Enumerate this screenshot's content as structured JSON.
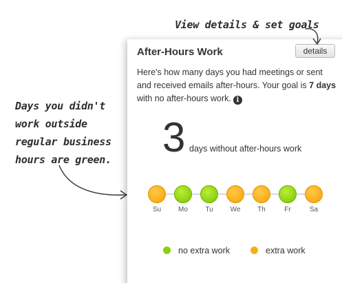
{
  "annotations": {
    "top": "View details & set goals",
    "left_lines": [
      "Days you didn't",
      "work outside",
      "regular business",
      "hours are green."
    ]
  },
  "card": {
    "title": "After-Hours Work",
    "details_label": "details",
    "description_pre": "Here's how many days you had meetings or sent and received emails after-hours. Your goal is ",
    "goal_bold": "7 days",
    "description_post": " with no after-hours work.",
    "info_icon": "info-icon",
    "count": "3",
    "count_caption": "days without after-hours work"
  },
  "days": [
    {
      "label": "Su",
      "status": "extra"
    },
    {
      "label": "Mo",
      "status": "none"
    },
    {
      "label": "Tu",
      "status": "none"
    },
    {
      "label": "We",
      "status": "extra"
    },
    {
      "label": "Th",
      "status": "extra"
    },
    {
      "label": "Fr",
      "status": "none"
    },
    {
      "label": "Sa",
      "status": "extra"
    }
  ],
  "legend": {
    "none_label": "no extra work",
    "extra_label": "extra work"
  },
  "colors": {
    "no_extra_work": "#8bd10c",
    "extra_work": "#f8ae12"
  }
}
